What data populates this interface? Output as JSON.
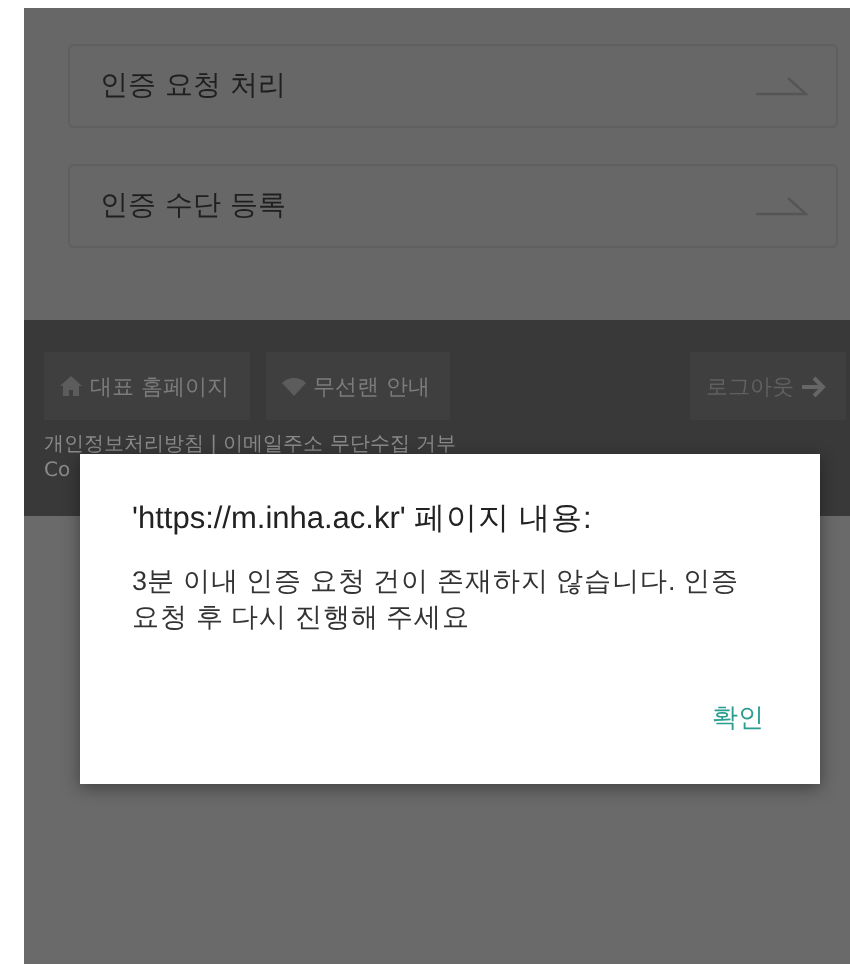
{
  "menu_items": [
    {
      "label": "인증 요청 처리"
    },
    {
      "label": "인증 수단 등록"
    }
  ],
  "footer": {
    "links": [
      {
        "kind": "home",
        "label": "대표 홈페이지"
      },
      {
        "kind": "wifi",
        "label": "무선랜 안내"
      }
    ],
    "logout": {
      "label": "로그아웃"
    },
    "lines": [
      "개인정보처리방침 | 이메일주소 무단수집 거부",
      "Co"
    ]
  },
  "dialog": {
    "title": "'https://m.inha.ac.kr' 페이지 내용:",
    "message": "3분 이내 인증 요청 건이 존재하지 않습니다. 인증 요청 후 다시 진행해 주세요",
    "button": "확인"
  }
}
